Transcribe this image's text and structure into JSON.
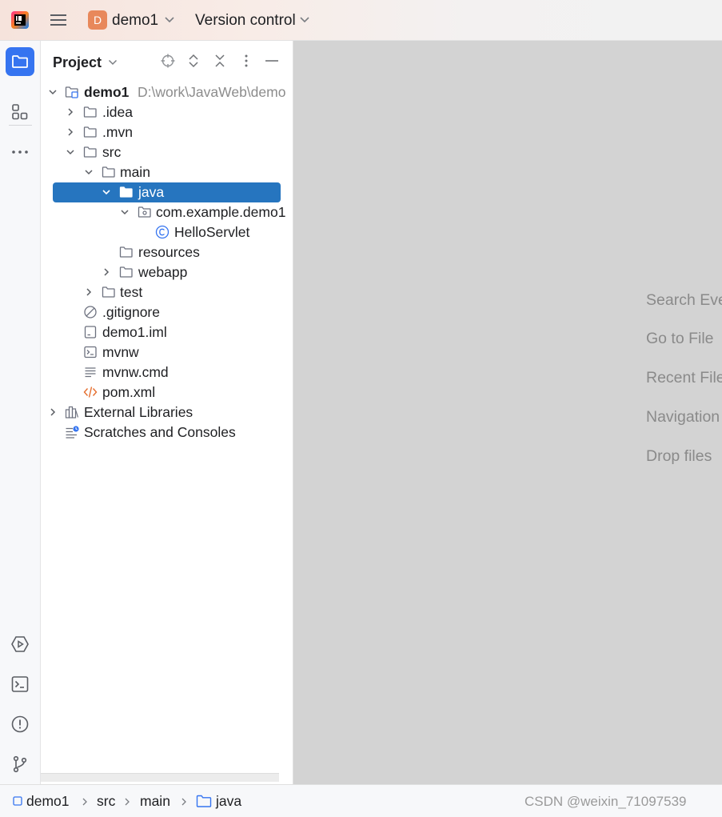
{
  "titlebar": {
    "project_badge": "D",
    "project_name": "demo1",
    "vcs_label": "Version control"
  },
  "panel": {
    "title": "Project"
  },
  "tree": {
    "root_name": "demo1",
    "root_path": "D:\\work\\JavaWeb\\demo",
    "idea": ".idea",
    "mvn": ".mvn",
    "src": "src",
    "main": "main",
    "java": "java",
    "package": "com.example.demo1",
    "servlet": "HelloServlet",
    "resources": "resources",
    "webapp": "webapp",
    "test": "test",
    "gitignore": ".gitignore",
    "iml": "demo1.iml",
    "mvnw": "mvnw",
    "mvnw_cmd": "mvnw.cmd",
    "pom": "pom.xml",
    "ext_libs": "External Libraries",
    "scratches": "Scratches and Consoles"
  },
  "editor": {
    "hints": [
      "Search Eve",
      "Go to File",
      "Recent File",
      "Navigation",
      "Drop files"
    ]
  },
  "statusbar": {
    "crumbs": [
      "demo1",
      "src",
      "main",
      "java"
    ],
    "watermark": "CSDN @weixin_71097539"
  },
  "colors": {
    "accent": "#3574f0",
    "selection": "#2675bf",
    "project_badge": "#e8885b",
    "editor_bg": "#d3d3d3"
  },
  "icons": {
    "app": "intellij-logo-icon",
    "menu": "hamburger-icon",
    "project_tool": "folder-icon",
    "structure_tool": "structure-icon",
    "more_tools": "more-horizontal-icon",
    "run": "run-icon",
    "terminal": "terminal-icon",
    "problems": "problems-icon",
    "git": "git-branch-icon"
  }
}
